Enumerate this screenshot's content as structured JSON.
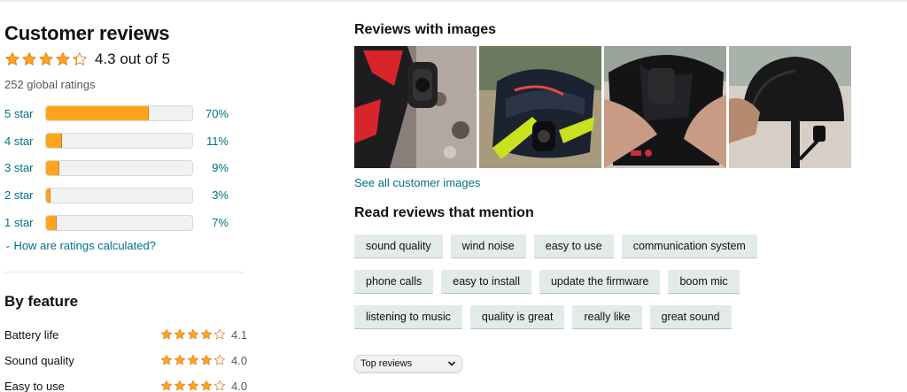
{
  "summary": {
    "title": "Customer reviews",
    "rating": 4.3,
    "rating_text": "4.3 out of 5",
    "global_ratings": "252 global ratings",
    "star_color": "#ffa41c"
  },
  "histogram": [
    {
      "label": "5 star",
      "percent_text": "70%",
      "fraction": 0.7
    },
    {
      "label": "4 star",
      "percent_text": "11%",
      "fraction": 0.11
    },
    {
      "label": "3 star",
      "percent_text": "9%",
      "fraction": 0.09
    },
    {
      "label": "2 star",
      "percent_text": "3%",
      "fraction": 0.03
    },
    {
      "label": "1 star",
      "percent_text": "7%",
      "fraction": 0.07
    }
  ],
  "how_link": "How are ratings calculated?",
  "by_feature": {
    "title": "By feature",
    "items": [
      {
        "name": "Battery life",
        "rating": 4.1,
        "rating_text": "4.1"
      },
      {
        "name": "Sound quality",
        "rating": 4.0,
        "rating_text": "4.0"
      },
      {
        "name": "Easy to use",
        "rating": 4.0,
        "rating_text": "4.0"
      }
    ]
  },
  "images_section": {
    "title": "Reviews with images",
    "see_all": "See all customer images"
  },
  "mentions": {
    "title": "Read reviews that mention",
    "chips": [
      "sound quality",
      "wind noise",
      "easy to use",
      "communication system",
      "phone calls",
      "easy to install",
      "update the firmware",
      "boom mic",
      "listening to music",
      "quality is great",
      "really like",
      "great sound"
    ]
  },
  "sort": {
    "selected": "Top reviews"
  }
}
